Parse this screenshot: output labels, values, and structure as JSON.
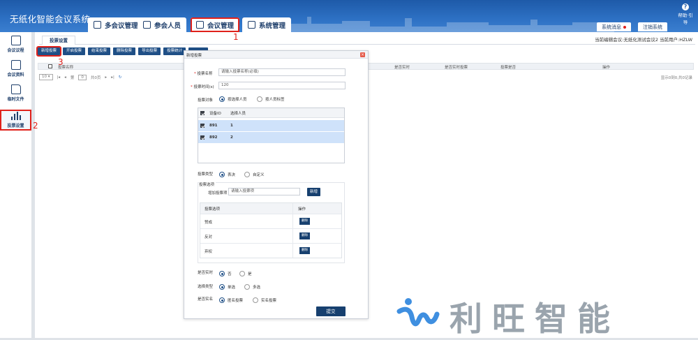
{
  "header": {
    "app_title": "无纸化智能会议系统",
    "nav_tabs": [
      {
        "label": "多会议管理"
      },
      {
        "label": "参会人员"
      },
      {
        "label": "会议管理"
      },
      {
        "label": "系统管理"
      }
    ],
    "sys_msg": "系统消息",
    "logout": "注销系统",
    "help": "帮助·引导",
    "help_glyph": "?"
  },
  "sidebar": {
    "items": [
      {
        "label": "会议议程",
        "icon": "agenda-icon"
      },
      {
        "label": "会议资料",
        "icon": "documents-icon"
      },
      {
        "label": "临时文件",
        "icon": "folder-icon"
      },
      {
        "label": "投票设置",
        "icon": "bar-chart-icon"
      }
    ]
  },
  "annotations": {
    "n1": "1",
    "n2": "2",
    "n3": "3"
  },
  "main": {
    "tab": "投票设置",
    "breadcrumb": "当前编辑会议:无纸化测试会议2    当前用户:HZLW",
    "toolbar": [
      "新增投票",
      "开启投票",
      "结束投票",
      "删除投票",
      "导出投票",
      "投票统计",
      ""
    ],
    "columns": [
      "投票名称",
      "是否实时",
      "是否实时投票",
      "投票是否",
      "操作"
    ],
    "pager": {
      "size": "10",
      "page_prefix": "第",
      "page": "0",
      "page_suffix": "共0页",
      "right": "显示0到0,共0记录"
    }
  },
  "modal": {
    "title": "新增投票",
    "close": "×",
    "name_label": "投票名称",
    "name_placeholder": "请输入投票名称(必填)",
    "time_label": "投票时间(s)",
    "time_value": "120",
    "object_label": "投票对象",
    "object_options": [
      "按选择人员",
      "按人员标签"
    ],
    "people_headers": [
      "设备ID",
      "选择人员"
    ],
    "people_rows": [
      {
        "id": "891",
        "name": "1"
      },
      {
        "id": "892",
        "name": "2"
      }
    ],
    "type_label": "投票类型",
    "type_options": [
      "表决",
      "自定义"
    ],
    "options_label": "投票选项",
    "add_option_label": "增加投票项",
    "add_option_placeholder": "请输入投票项",
    "add_button": "新增",
    "options_headers": [
      "投票选项",
      "操作"
    ],
    "options_rows": [
      {
        "name": "赞成",
        "action": "删除"
      },
      {
        "name": "反对",
        "action": "删除"
      },
      {
        "name": "弃权",
        "action": "删除"
      }
    ],
    "realtime_label": "是否实时",
    "realtime_options": [
      "否",
      "是"
    ],
    "select_label": "选择类型",
    "select_options": [
      "单选",
      "多选"
    ],
    "anon_label": "是否实名",
    "anon_options": [
      "匿名投票",
      "实名投票"
    ],
    "submit": "提交"
  },
  "brand": {
    "text": "利旺智能"
  }
}
